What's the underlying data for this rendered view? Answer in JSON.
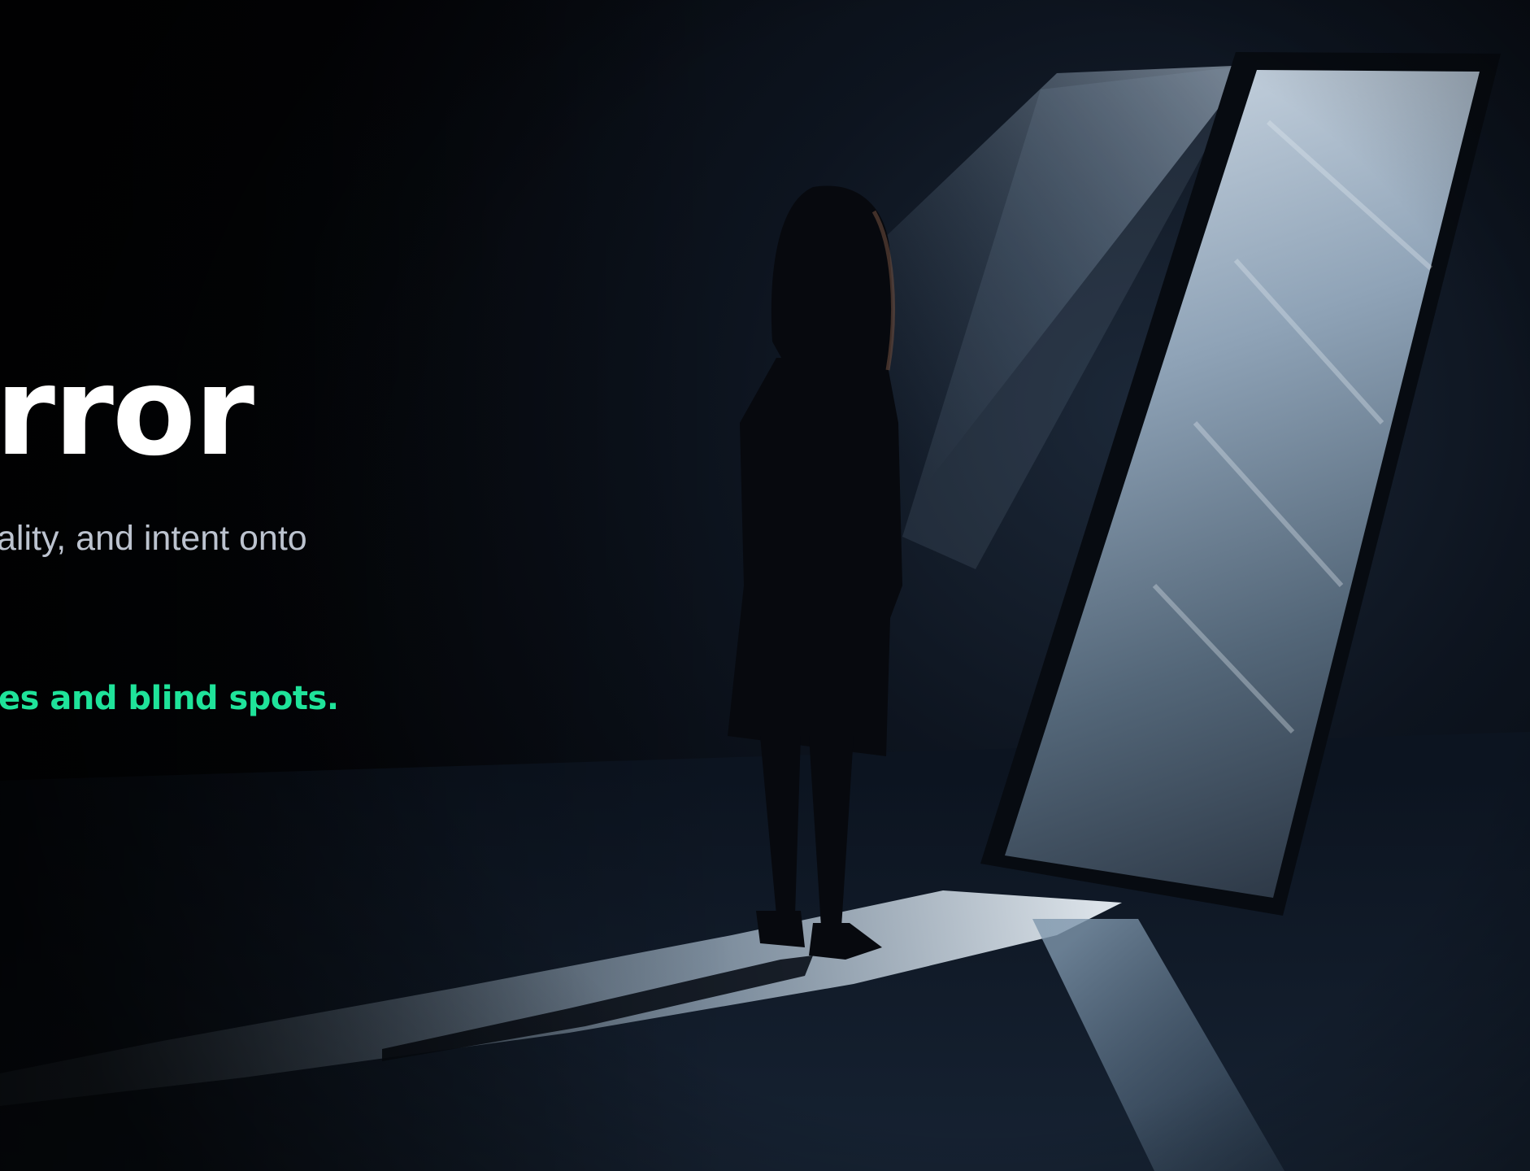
{
  "hero": {
    "headline": "rror",
    "subtitle": "ality, and intent onto",
    "tagline": "es and blind spots."
  },
  "colors": {
    "background": "#06090f",
    "headline": "#ffffff",
    "subtitle": "#bcc3cf",
    "accent": "#1fe39a",
    "light_beam": "#9fb6cc"
  },
  "image": {
    "subject": "silhouette of a woman facing a tall leaning mirror in a dark room lit by a beam of light"
  }
}
